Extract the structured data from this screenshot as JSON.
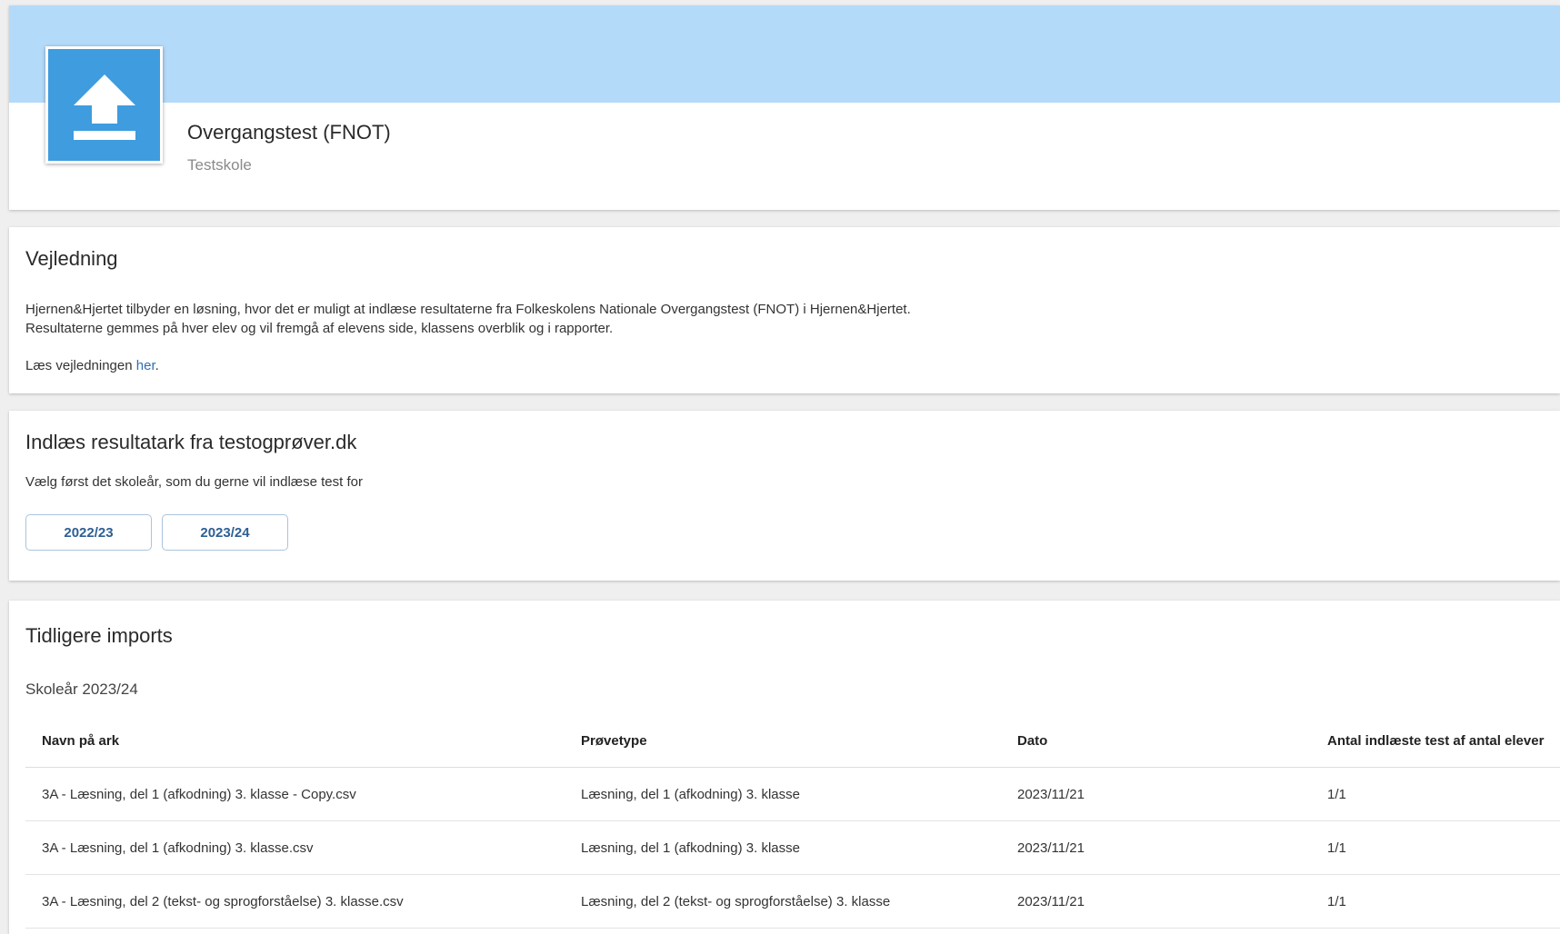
{
  "header": {
    "title": "Overgangstest (FNOT)",
    "subtitle": "Testskole",
    "icon": "upload-icon",
    "banner_color": "#b4dafa",
    "icon_color": "#3e9cdf"
  },
  "guide": {
    "heading": "Vejledning",
    "line1": "Hjernen&Hjertet tilbyder en løsning, hvor det er muligt at indlæse resultaterne fra Folkeskolens Nationale Overgangstest (FNOT) i Hjernen&Hjertet.",
    "line2": "Resultaterne gemmes på hver elev og vil fremgå af elevens side, klassens overblik og i rapporter.",
    "link_prefix": "Læs vejledningen ",
    "link_text": "her",
    "link_suffix": "."
  },
  "import": {
    "heading": "Indlæs resultatark fra testogprøver.dk",
    "description": "Vælg først det skoleår, som du gerne vil indlæse test for",
    "years": [
      "2022/23",
      "2023/24"
    ]
  },
  "history": {
    "heading": "Tidligere imports",
    "school_year": "Skoleår 2023/24",
    "columns": [
      "Navn på ark",
      "Prøvetype",
      "Dato",
      "Antal indlæste test af antal elever"
    ],
    "rows": [
      [
        "3A - Læsning, del 1 (afkodning) 3. klasse - Copy.csv",
        "Læsning, del 1 (afkodning) 3. klasse",
        "2023/11/21",
        "1/1"
      ],
      [
        "3A - Læsning, del 1 (afkodning) 3. klasse.csv",
        "Læsning, del 1 (afkodning) 3. klasse",
        "2023/11/21",
        "1/1"
      ],
      [
        "3A - Læsning, del 2 (tekst- og sprogforståelse) 3. klasse.csv",
        "Læsning, del 2 (tekst- og sprogforståelse) 3. klasse",
        "2023/11/21",
        "1/1"
      ]
    ]
  }
}
